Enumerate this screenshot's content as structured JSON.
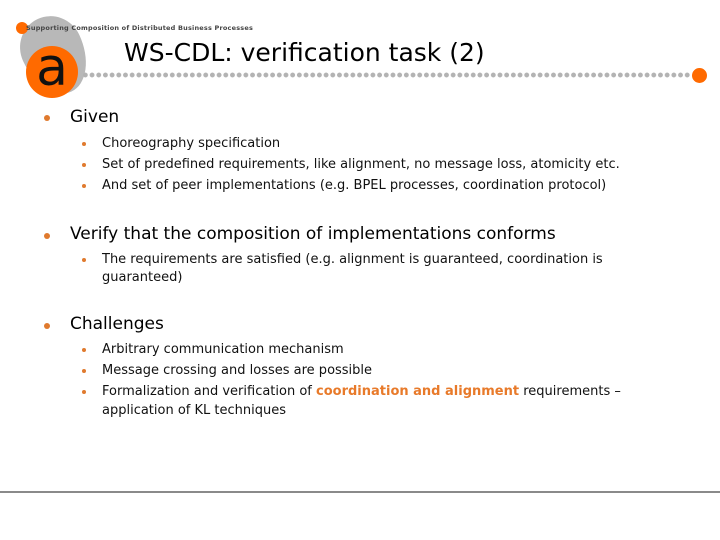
{
  "header": {
    "logo_letter": "a",
    "tagline": "Supporting Composition of Distributed Business Processes",
    "title": "WS-CDL: verification task (2)"
  },
  "colors": {
    "accent": "#ff6a00",
    "bullet": "#e07a2e",
    "highlight": "#e87a2a",
    "dots": "#b3b3b3"
  },
  "sections": [
    {
      "heading": "Given",
      "items": [
        "Choreography specification",
        "Set of predefined requirements, like alignment, no message loss, atomicity etc.",
        "And set of peer implementations (e.g. BPEL processes, coordination protocol)"
      ]
    },
    {
      "heading": "Verify that the composition of implementations conforms",
      "items": [
        "The requirements are satisfied (e.g. alignment is guaranteed, coordination is",
        "guaranteed)"
      ]
    },
    {
      "heading": "Challenges",
      "items": [
        "Arbitrary communication mechanism",
        "Message crossing and losses are possible"
      ],
      "last_item": {
        "before": "Formalization and verification of ",
        "highlight": "coordination and alignment",
        "after": " requirements –",
        "continuation": "application of KL techniques"
      }
    }
  ]
}
